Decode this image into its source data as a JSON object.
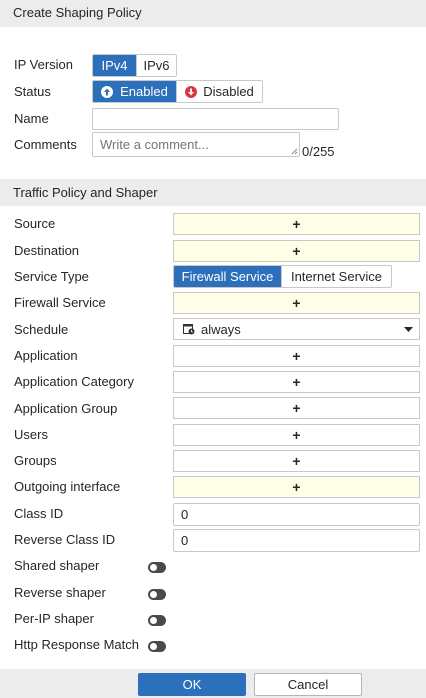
{
  "header": {
    "title": "Create Shaping Policy"
  },
  "ip_version": {
    "label": "IP Version",
    "options": [
      "IPv4",
      "IPv6"
    ],
    "selected": "IPv4"
  },
  "status": {
    "label": "Status",
    "enabled_label": "Enabled",
    "disabled_label": "Disabled",
    "selected": "Enabled"
  },
  "name": {
    "label": "Name",
    "value": ""
  },
  "comments": {
    "label": "Comments",
    "placeholder": "Write a comment...",
    "counter": "0/255"
  },
  "traffic_section": {
    "title": "Traffic Policy and Shaper"
  },
  "fields": {
    "source": "Source",
    "destination": "Destination",
    "service_type": "Service Type",
    "firewall_service": "Firewall Service",
    "schedule": "Schedule",
    "application": "Application",
    "application_category": "Application Category",
    "application_group": "Application Group",
    "users": "Users",
    "groups": "Groups",
    "outgoing_interface": "Outgoing interface",
    "class_id": "Class ID",
    "reverse_class_id": "Reverse Class ID",
    "shared_shaper": "Shared shaper",
    "reverse_shaper": "Reverse shaper",
    "per_ip_shaper": "Per-IP shaper",
    "http_response_match": "Http Response Match"
  },
  "service_type": {
    "options": [
      "Firewall Service",
      "Internet Service"
    ],
    "selected": "Firewall Service"
  },
  "schedule": {
    "value": "always"
  },
  "add_symbol": "+",
  "class_id": {
    "value": "0"
  },
  "reverse_class_id": {
    "value": "0"
  },
  "toggles": {
    "shared_shaper": false,
    "reverse_shaper": false,
    "per_ip_shaper": false,
    "http_response_match": false
  },
  "buttons": {
    "ok": "OK",
    "cancel": "Cancel"
  },
  "colors": {
    "accent": "#2c6fbb",
    "required_bg": "#fffee6",
    "enabled_icon": "#2c6fbb",
    "disabled_icon": "#d9363e"
  }
}
